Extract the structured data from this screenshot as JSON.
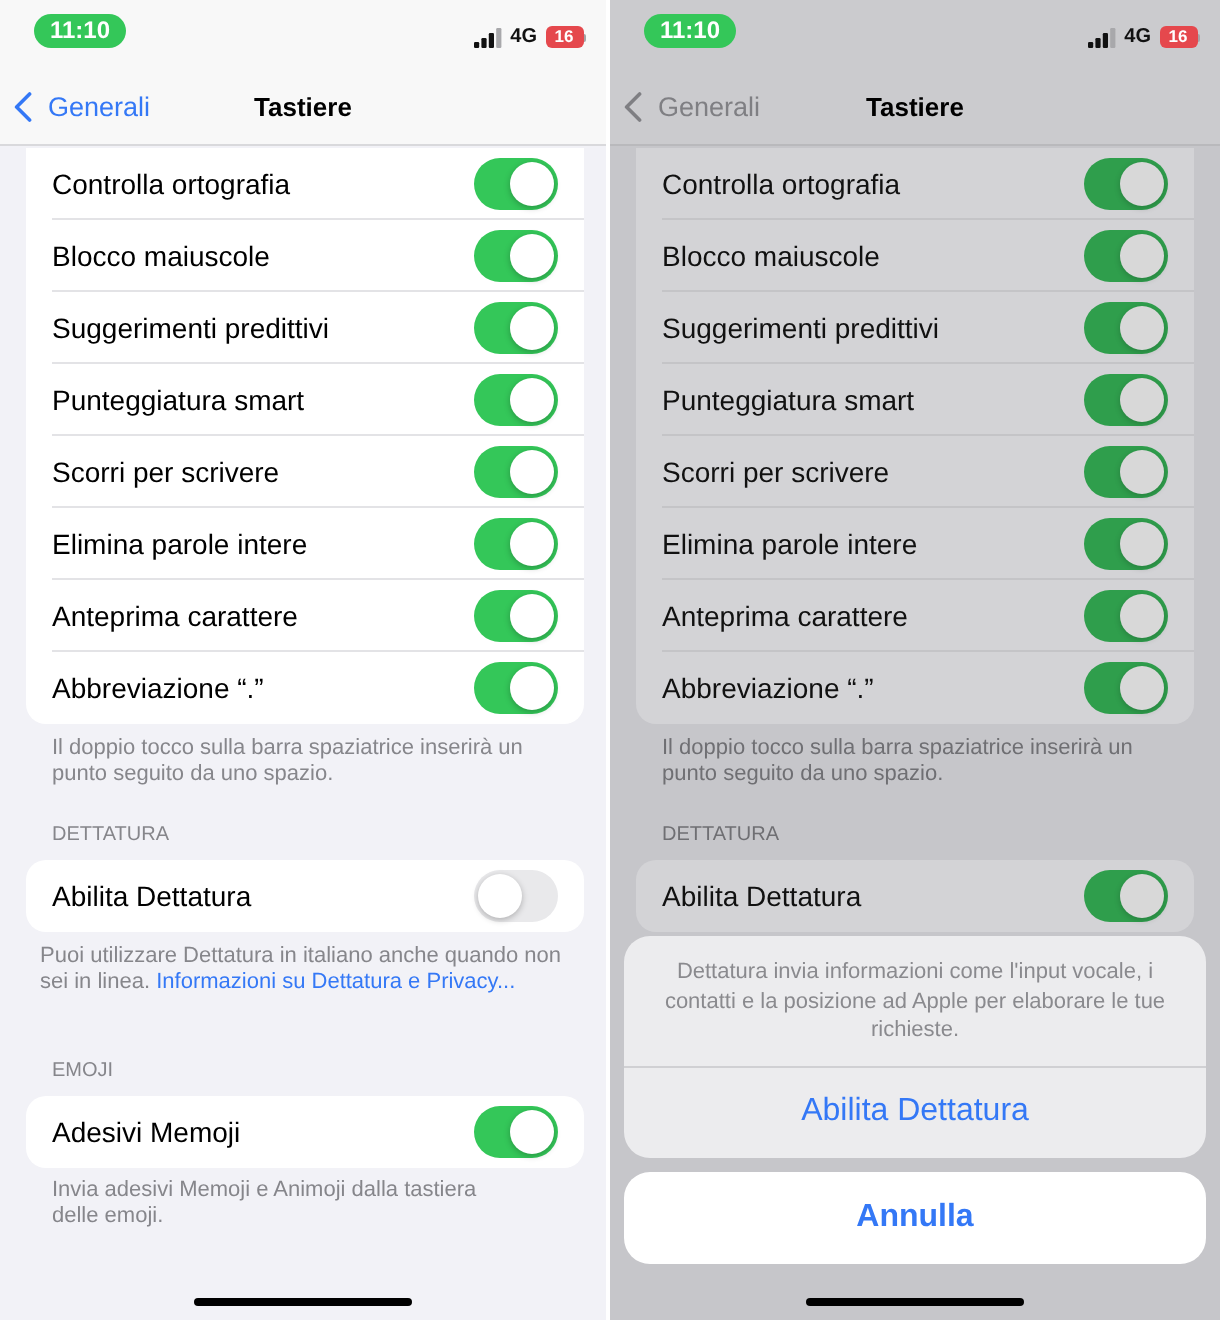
{
  "screens": [
    {
      "dimmed": false,
      "status_bar": {
        "time": "11:10",
        "network": "4G",
        "battery": "16"
      },
      "nav": {
        "back": "Generali",
        "title": "Tastiere"
      },
      "sections": [
        {
          "rows": [
            {
              "label": "Controlla ortografia",
              "on": true
            },
            {
              "label": "Blocco maiuscole",
              "on": true
            },
            {
              "label": "Suggerimenti predittivi",
              "on": true
            },
            {
              "label": "Punteggiatura smart",
              "on": true
            },
            {
              "label": "Scorri per scrivere",
              "on": true
            },
            {
              "label": "Elimina parole intere",
              "on": true
            },
            {
              "label": "Anteprima carattere",
              "on": true
            },
            {
              "label": "Abbreviazione “.”",
              "on": true
            }
          ],
          "footer": {
            "text": "Il doppio tocco sulla barra spaziatrice inserirà un punto seguito da uno spazio."
          }
        },
        {
          "header": "DETTATURA",
          "rows": [
            {
              "label": "Abilita Dettatura",
              "on": false
            }
          ],
          "footer": {
            "text": "Puoi utilizzare Dettatura in italiano anche quando non sei in linea.",
            "link": "Informazioni su Dettatura e Privacy..."
          }
        },
        {
          "header": "EMOJI",
          "rows": [
            {
              "label": "Adesivi Memoji",
              "on": true
            }
          ],
          "footer": {
            "text": "Invia adesivi Memoji e Animoji dalla tastiera delle emoji."
          }
        }
      ]
    },
    {
      "dimmed": true,
      "status_bar": {
        "time": "11:10",
        "network": "4G",
        "battery": "16"
      },
      "nav": {
        "back": "Generali",
        "title": "Tastiere"
      },
      "sections": [
        {
          "rows": [
            {
              "label": "Controlla ortografia",
              "on": true
            },
            {
              "label": "Blocco maiuscole",
              "on": true
            },
            {
              "label": "Suggerimenti predittivi",
              "on": true
            },
            {
              "label": "Punteggiatura smart",
              "on": true
            },
            {
              "label": "Scorri per scrivere",
              "on": true
            },
            {
              "label": "Elimina parole intere",
              "on": true
            },
            {
              "label": "Anteprima carattere",
              "on": true
            },
            {
              "label": "Abbreviazione “.”",
              "on": true
            }
          ],
          "footer": {
            "text": "Il doppio tocco sulla barra spaziatrice inserirà un punto seguito da uno spazio."
          }
        },
        {
          "header": "DETTATURA",
          "rows": [
            {
              "label": "Abilita Dettatura",
              "on": true
            }
          ]
        }
      ],
      "action_sheet": {
        "message": "Dettatura invia informazioni come l'input vocale, i contatti e la posizione ad Apple per elaborare le tue richieste.",
        "actions": [
          "Abilita Dettatura"
        ],
        "cancel": "Annulla"
      }
    }
  ]
}
